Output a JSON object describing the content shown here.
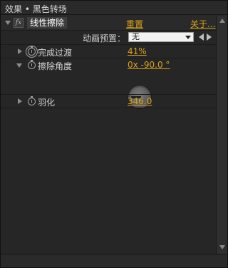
{
  "window": {
    "title": "效果 • 黑色转场"
  },
  "effect": {
    "fx_icon": "fx",
    "name": "线性擦除",
    "reset_label": "重置",
    "about_label": "关于..."
  },
  "preset": {
    "label": "动画预置：",
    "value": "无"
  },
  "properties": [
    {
      "label": "完成过渡",
      "value": "41%",
      "icon": "stopwatch-icon-keyframed"
    },
    {
      "label": "擦除角度",
      "value": "0x -90.0 °",
      "icon": "stopwatch-icon"
    },
    {
      "label": "羽化",
      "value": "346.0",
      "icon": "stopwatch-icon"
    }
  ],
  "colors": {
    "accent": "#d9a21b",
    "background": "#262626",
    "text": "#c8c8c8"
  },
  "dial": {
    "angle_deg": -90.0,
    "control": "angle-dial"
  }
}
